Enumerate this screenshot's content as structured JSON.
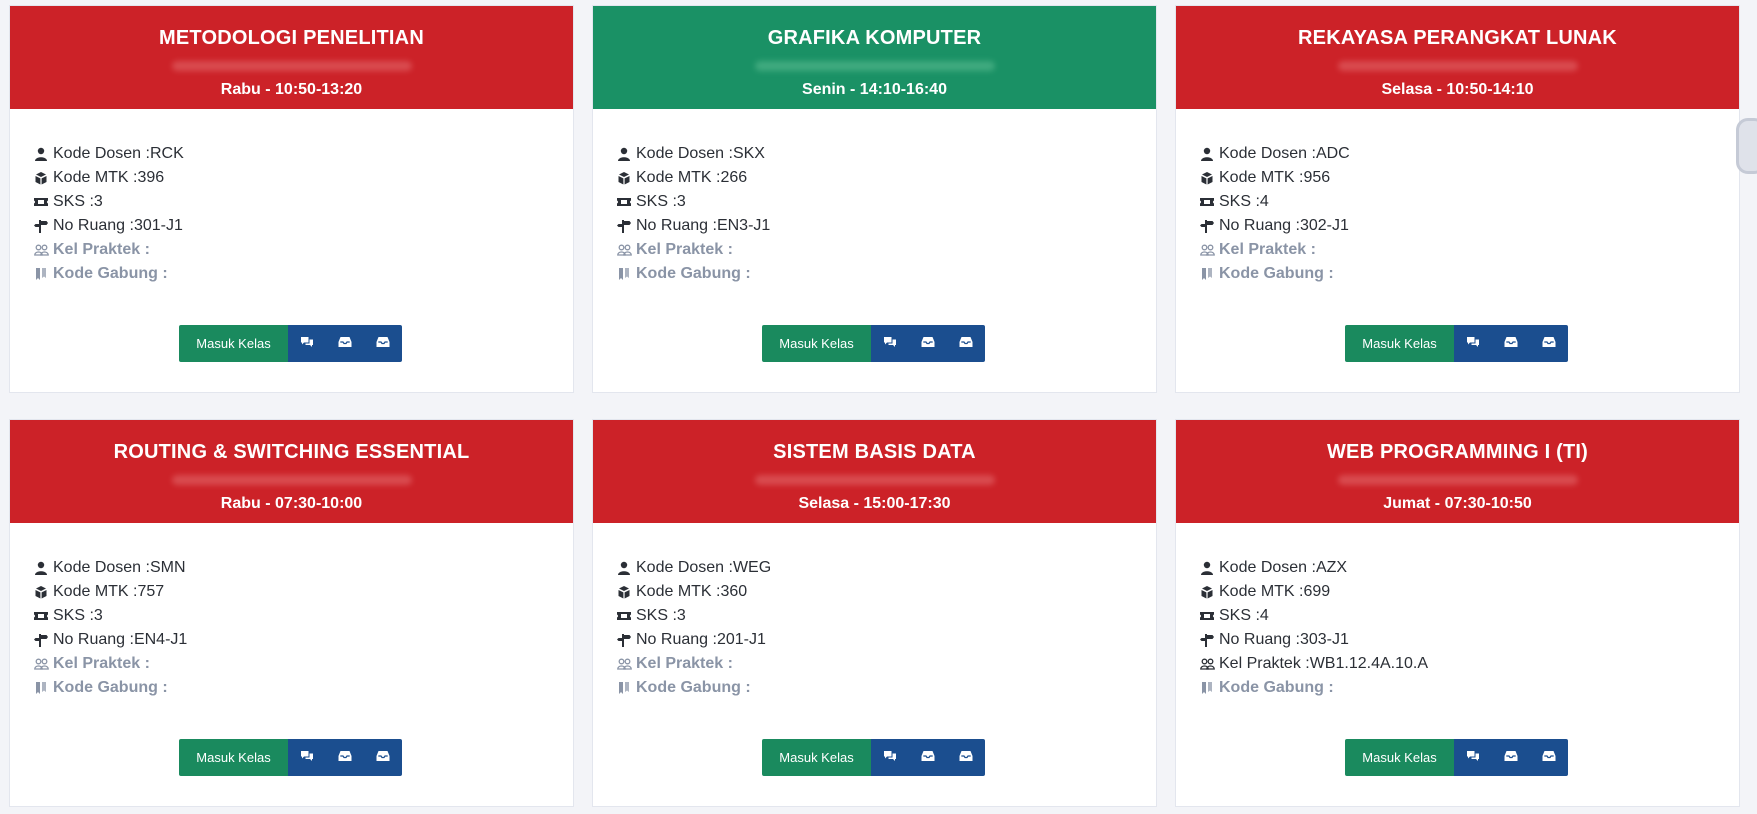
{
  "labels": {
    "kode_dosen": "Kode Dosen : ",
    "kode_mtk": "Kode MTK : ",
    "sks": "SKS : ",
    "no_ruang": "No Ruang : ",
    "kel_praktek": "Kel Praktek : ",
    "kode_gabung": "Kode Gabung : ",
    "masuk_kelas": "Masuk Kelas"
  },
  "colors": {
    "header_red": "#cc2228",
    "header_green": "#1a9165",
    "button_green": "#1a8a5e",
    "button_blue": "#1b4e8f",
    "muted_text": "#8a94a6"
  },
  "icons": {
    "dosen": "user-icon",
    "mtk": "book-icon",
    "sks": "ticket-icon",
    "ruang": "signpost-icon",
    "praktek": "group-icon",
    "gabung": "bookmark-icon",
    "button_1": "chat-icon",
    "button_2": "inbox-icon",
    "button_3": "inbox-icon"
  },
  "courses": [
    {
      "title": "METODOLOGI PENELITIAN",
      "schedule": "Rabu - 10:50-13:20",
      "header_color": "red",
      "kode_dosen": "RCK",
      "kode_mtk": "396",
      "sks": "3",
      "no_ruang": "301-J1",
      "kel_praktek": "",
      "kode_gabung": ""
    },
    {
      "title": "GRAFIKA KOMPUTER",
      "schedule": "Senin - 14:10-16:40",
      "header_color": "green",
      "kode_dosen": "SKX",
      "kode_mtk": "266",
      "sks": "3",
      "no_ruang": "EN3-J1",
      "kel_praktek": "",
      "kode_gabung": ""
    },
    {
      "title": "REKAYASA PERANGKAT LUNAK",
      "schedule": "Selasa - 10:50-14:10",
      "header_color": "red",
      "kode_dosen": "ADC",
      "kode_mtk": "956",
      "sks": "4",
      "no_ruang": "302-J1",
      "kel_praktek": "",
      "kode_gabung": ""
    },
    {
      "title": "ROUTING & SWITCHING ESSENTIAL",
      "schedule": "Rabu - 07:30-10:00",
      "header_color": "red",
      "kode_dosen": "SMN",
      "kode_mtk": "757",
      "sks": "3",
      "no_ruang": "EN4-J1",
      "kel_praktek": "",
      "kode_gabung": ""
    },
    {
      "title": "SISTEM BASIS DATA",
      "schedule": "Selasa - 15:00-17:30",
      "header_color": "red",
      "kode_dosen": "WEG",
      "kode_mtk": "360",
      "sks": "3",
      "no_ruang": "201-J1",
      "kel_praktek": "",
      "kode_gabung": ""
    },
    {
      "title": "WEB PROGRAMMING I (TI)",
      "schedule": "Jumat - 07:30-10:50",
      "header_color": "red",
      "kode_dosen": "AZX",
      "kode_mtk": "699",
      "sks": "4",
      "no_ruang": "303-J1",
      "kel_praktek": "WB1.12.4A.10.A",
      "kode_gabung": ""
    }
  ]
}
